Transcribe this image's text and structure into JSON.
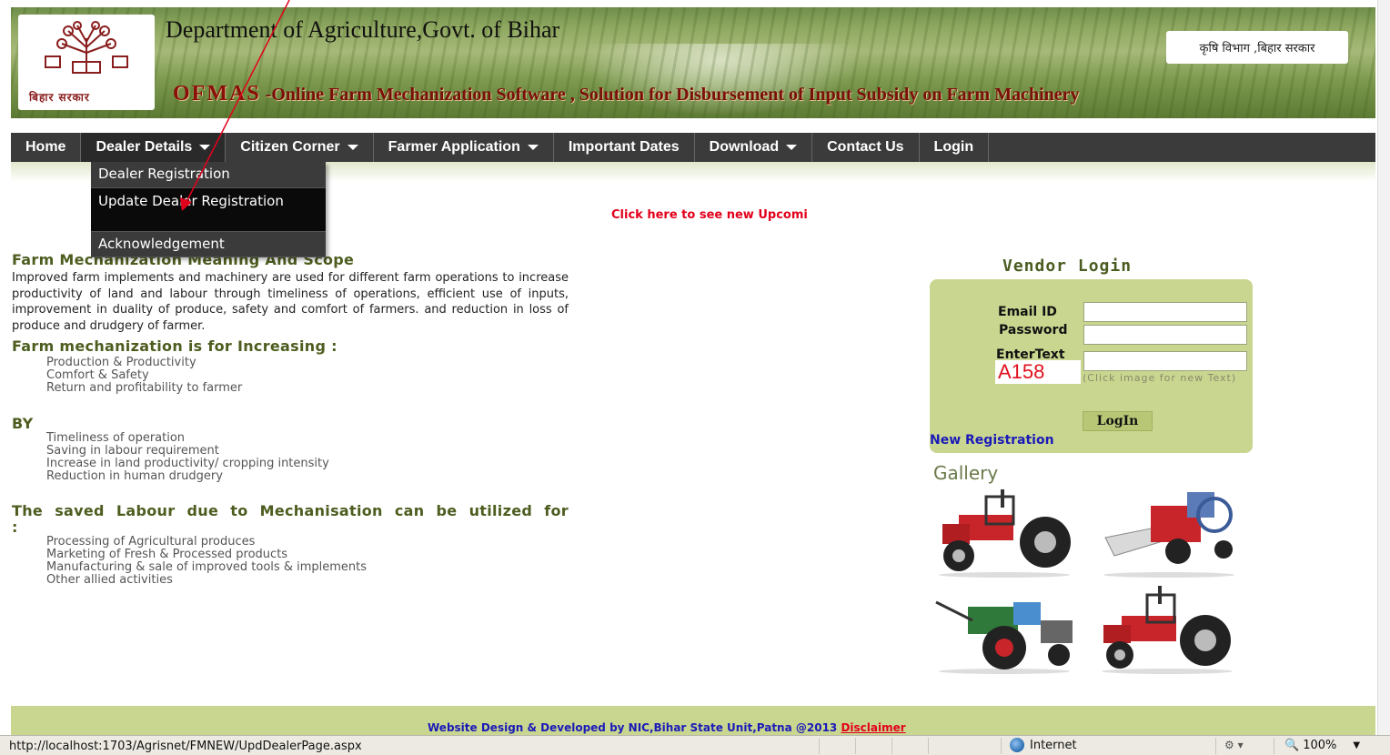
{
  "header": {
    "dept_title": "Department of Agriculture,Govt. of Bihar",
    "hindi_title": "कृषि विभाग ,बिहार सरकार",
    "logo_text": "बिहार सरकार",
    "ofmas_big": "OFMAS",
    "ofmas_tagline": " -Online Farm Mechanization Software , Solution for Disbursement of Input Subsidy on Farm Machinery"
  },
  "nav": {
    "items": [
      {
        "label": "Home"
      },
      {
        "label": "Dealer Details"
      },
      {
        "label": "Citizen Corner"
      },
      {
        "label": "Farmer Application"
      },
      {
        "label": "Important Dates"
      },
      {
        "label": "Download"
      },
      {
        "label": "Contact Us"
      },
      {
        "label": "Login"
      }
    ]
  },
  "dropdown": {
    "items": [
      {
        "label": "Dealer Registration"
      },
      {
        "label": "Update Dealer Registration"
      },
      {
        "label": "Acknowledgement"
      }
    ]
  },
  "marquee": "Click here to see new Upcomi",
  "content": {
    "heading1": "Farm Mechanization Meaning And Scope",
    "para1": "Improved farm implements and machinery are used for different farm operations to increase productivity of land and labour through timeliness of operations, efficient use of inputs, improvement in duality of produce, safety and comfort of farmers. and reduction in loss of produce and drudgery of farmer.",
    "heading2": "Farm mechanization is for Increasing :",
    "list1": [
      "Production & Productivity",
      "Comfort & Safety",
      "Return and profitability to farmer"
    ],
    "heading3": "BY",
    "list2": [
      "Timeliness of operation",
      "Saving in labour requirement",
      "Increase in land productivity/ cropping intensity",
      "Reduction in human drudgery"
    ],
    "heading4": "The saved Labour due to Mechanisation can be utilized for :",
    "list3": [
      "Processing of Agricultural produces",
      "Marketing of Fresh & Processed products",
      "Manufacturing & sale of improved tools & implements",
      "Other allied activities"
    ]
  },
  "login": {
    "title": "Vendor Login",
    "email_label": "Email ID",
    "password_label": "Password",
    "entertext_label": "EnterText",
    "email_value": "",
    "password_value": "",
    "captcha_input_value": "",
    "captcha_text": "A158",
    "captcha_hint": "(Click image for new Text)",
    "login_button": "LogIn",
    "new_registration": "New Registration"
  },
  "gallery": {
    "title": "Gallery",
    "images": [
      "red-tractor-icon",
      "harvester-icon",
      "power-tiller-icon",
      "red-tractor-icon"
    ]
  },
  "footer": {
    "text": "Website Design & Developed by NIC,Bihar State Unit,Patna @2013 ",
    "disclaimer": "Disclaimer"
  },
  "statusbar": {
    "url": "http://localhost:1703/Agrisnet/FMNEW/UpdDealerPage.aspx",
    "zone": "Internet",
    "zoom": "100%"
  },
  "colors": {
    "nav_bg": "#3b3b3b",
    "accent_green": "#c9d690",
    "heading_green": "#4d5d1f",
    "link_blue": "#1a1ab8",
    "alert_red": "#e3001b"
  }
}
